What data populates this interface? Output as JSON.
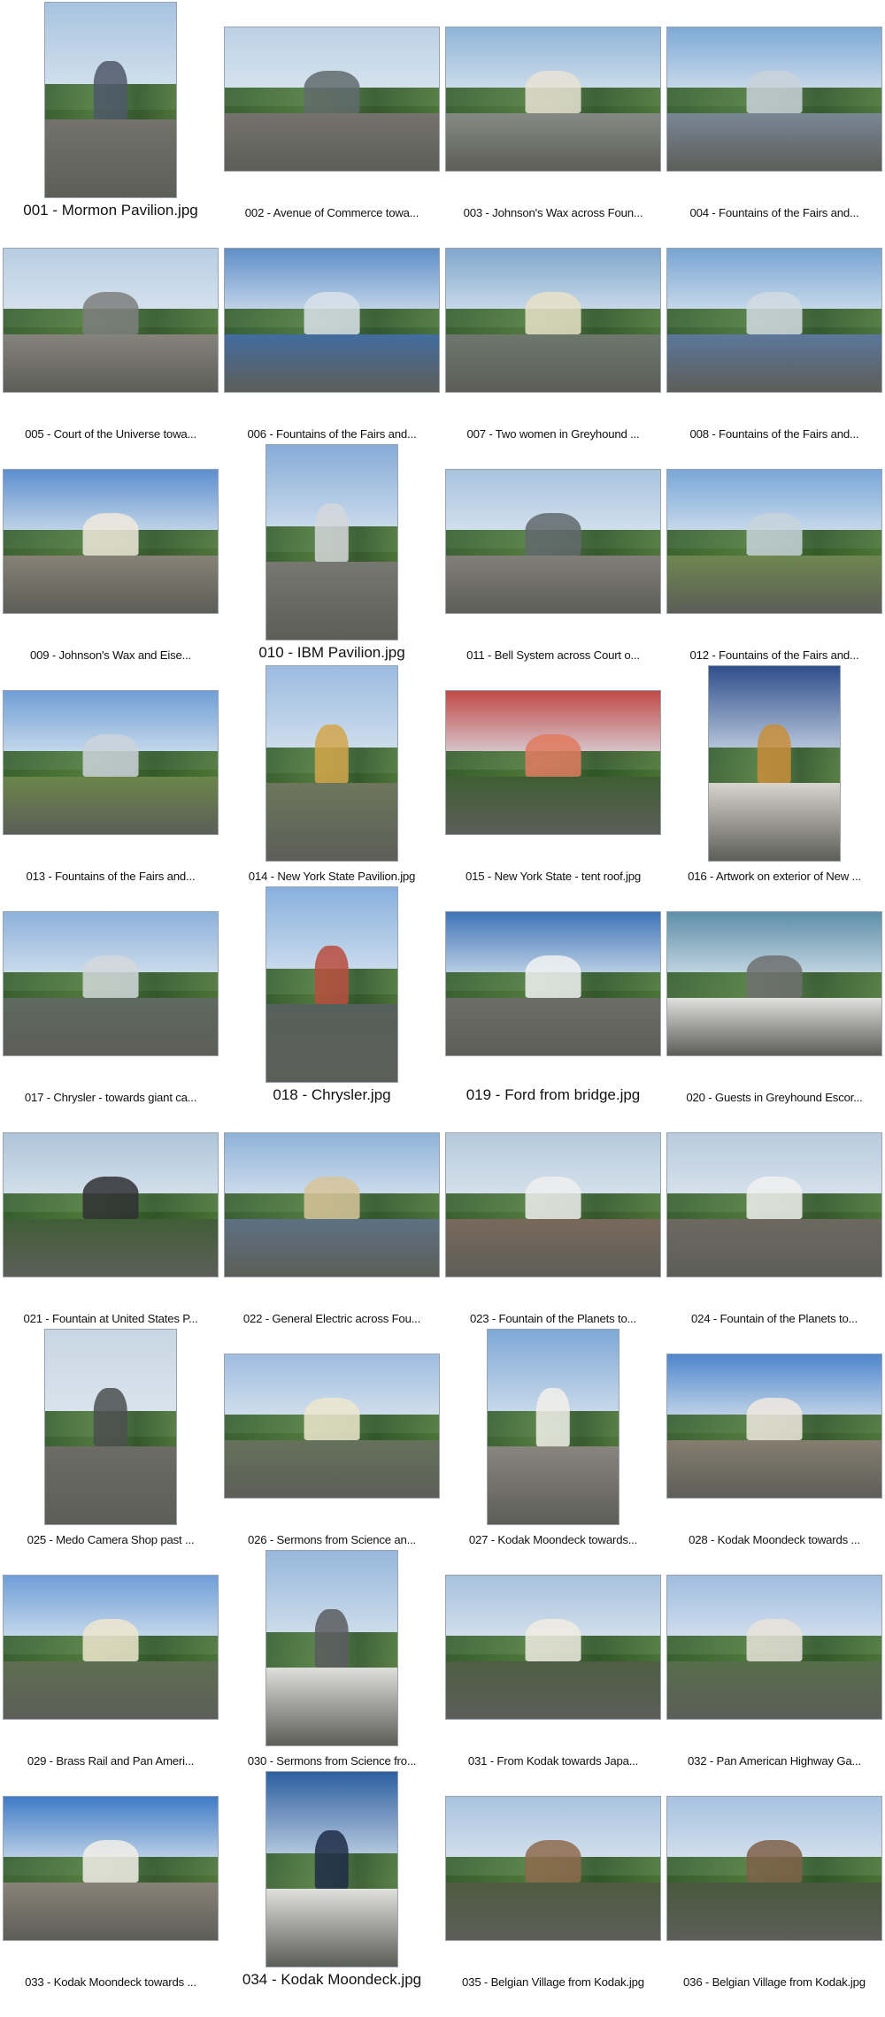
{
  "photos": [
    {
      "caption": "001 - Mormon Pavilion.jpg",
      "orientation": "portrait",
      "sky": "#a7c3e0",
      "ground": "#75756d",
      "accent": "#4e5868"
    },
    {
      "caption": "002 - Avenue of Commerce towa...",
      "orientation": "landscape",
      "sky": "#bcd1e6",
      "ground": "#77766f",
      "accent": "#5f6b6c"
    },
    {
      "caption": "003 - Johnson's Wax across Foun...",
      "orientation": "landscape",
      "sky": "#8fb4d8",
      "ground": "#8c8f89",
      "accent": "#e8e3d6"
    },
    {
      "caption": "004 - Fountains of the Fairs and...",
      "orientation": "landscape",
      "sky": "#7ea9d6",
      "ground": "#7d8c9d",
      "accent": "#c8d2d9"
    },
    {
      "caption": "005 - Court of the Universe towa...",
      "orientation": "landscape",
      "sky": "#b8cde3",
      "ground": "#8a8880",
      "accent": "#7c7f7c"
    },
    {
      "caption": "006 - Fountains of the Fairs and...",
      "orientation": "landscape",
      "sky": "#5f8fc8",
      "ground": "#3f6ea8",
      "accent": "#d8e2ea"
    },
    {
      "caption": "007 - Two women in Greyhound ...",
      "orientation": "landscape",
      "sky": "#7fa7cc",
      "ground": "#6f7a6f",
      "accent": "#e8e2c8"
    },
    {
      "caption": "008 - Fountains of the Fairs and...",
      "orientation": "landscape",
      "sky": "#78a5d3",
      "ground": "#5c7aa3",
      "accent": "#d1dbe2"
    },
    {
      "caption": "009 - Johnson's Wax and Eise...",
      "orientation": "landscape",
      "sky": "#5d8fcf",
      "ground": "#8b8678",
      "accent": "#efe9dc"
    },
    {
      "caption": "010 - IBM Pavilion.jpg",
      "orientation": "portrait",
      "sky": "#86acd8",
      "ground": "#7b7a74",
      "accent": "#d3d7da"
    },
    {
      "caption": "011 - Bell System across Court o...",
      "orientation": "landscape",
      "sky": "#a9c3df",
      "ground": "#85837c",
      "accent": "#62686d"
    },
    {
      "caption": "012 - Fountains of the Fairs and...",
      "orientation": "landscape",
      "sky": "#79a7d8",
      "ground": "#6f8c4e",
      "accent": "#c7d3db"
    },
    {
      "caption": "013 - Fountains of the Fairs and...",
      "orientation": "landscape",
      "sky": "#6f9fd6",
      "ground": "#6c8a47",
      "accent": "#cbd4db"
    },
    {
      "caption": "014 - New York State Pavilion.jpg",
      "orientation": "portrait",
      "sky": "#9bbbe0",
      "ground": "#6f7a5c",
      "accent": "#d2a64b"
    },
    {
      "caption": "015 - New York State - tent roof.jpg",
      "orientation": "landscape",
      "sky": "#c04a48",
      "ground": "#3b5e2e",
      "accent": "#e07a5f"
    },
    {
      "caption": "016 - Artwork on exterior of New ...",
      "orientation": "portrait",
      "sky": "#2f4f8c",
      "ground": "#e7e3dc",
      "accent": "#c98d3a"
    },
    {
      "caption": "017 - Chrysler - towards giant ca...",
      "orientation": "landscape",
      "sky": "#8cb1db",
      "ground": "#5f6b5e",
      "accent": "#d4d8dc"
    },
    {
      "caption": "018 - Chrysler.jpg",
      "orientation": "portrait",
      "sky": "#88b0de",
      "ground": "#55605c",
      "accent": "#b84d3d"
    },
    {
      "caption": "019 - Ford from bridge.jpg",
      "orientation": "landscape",
      "sky": "#3f74b8",
      "ground": "#6e6f68",
      "accent": "#f1f2f2"
    },
    {
      "caption": "020 - Guests in Greyhound Escor...",
      "orientation": "landscape",
      "sky": "#5d8fa8",
      "ground": "#f0f0ee",
      "accent": "#6e706e"
    },
    {
      "caption": "021 - Fountain at United States P...",
      "orientation": "landscape",
      "sky": "#aec4d9",
      "ground": "#3d5e33",
      "accent": "#2f3033"
    },
    {
      "caption": "022 - General Electric across Fou...",
      "orientation": "landscape",
      "sky": "#8fb2d8",
      "ground": "#5d7388",
      "accent": "#d7c49a"
    },
    {
      "caption": "023 - Fountain of the Planets to...",
      "orientation": "landscape",
      "sky": "#b6cadc",
      "ground": "#7c6a5c",
      "accent": "#efefee"
    },
    {
      "caption": "024 - Fountain of the Planets to...",
      "orientation": "landscape",
      "sky": "#b9cbdd",
      "ground": "#6e6a62",
      "accent": "#f0f0ef"
    },
    {
      "caption": "025 - Medo Camera Shop past ...",
      "orientation": "portrait",
      "sky": "#c8d6e3",
      "ground": "#6e6d68",
      "accent": "#4b4f4f"
    },
    {
      "caption": "026 - Sermons from Science an...",
      "orientation": "landscape",
      "sky": "#9fbde0",
      "ground": "#66745a",
      "accent": "#ede6cf"
    },
    {
      "caption": "027 - Kodak Moondeck towards...",
      "orientation": "portrait",
      "sky": "#7fa8d6",
      "ground": "#8d8a82",
      "accent": "#f2f0ea"
    },
    {
      "caption": "028 - Kodak Moondeck towards ...",
      "orientation": "landscape",
      "sky": "#4f86cc",
      "ground": "#8a8273",
      "accent": "#efe9df"
    },
    {
      "caption": "029 - Brass Rail and Pan Ameri...",
      "orientation": "landscape",
      "sky": "#6f9fd8",
      "ground": "#5e7050",
      "accent": "#efe6cf"
    },
    {
      "caption": "030 - Sermons from Science fro...",
      "orientation": "portrait",
      "sky": "#97b7db",
      "ground": "#eeeeec",
      "accent": "#5a5c60"
    },
    {
      "caption": "031 - From Kodak towards Japa...",
      "orientation": "landscape",
      "sky": "#a8c1de",
      "ground": "#4c5e42",
      "accent": "#f0ece2"
    },
    {
      "caption": "032 - Pan American Highway Ga...",
      "orientation": "landscape",
      "sky": "#a0bde0",
      "ground": "#56704a",
      "accent": "#e8e3d9"
    },
    {
      "caption": "033 - Kodak Moondeck towards ...",
      "orientation": "landscape",
      "sky": "#3f7bc6",
      "ground": "#8d877c",
      "accent": "#f2efe7"
    },
    {
      "caption": "034 - Kodak Moondeck.jpg",
      "orientation": "portrait",
      "sky": "#2d5fa0",
      "ground": "#f1f1ef",
      "accent": "#1f2c46"
    },
    {
      "caption": "035 - Belgian Village from Kodak.jpg",
      "orientation": "landscape",
      "sky": "#a9c3df",
      "ground": "#4d5a3d",
      "accent": "#8e6a4c"
    },
    {
      "caption": "036 - Belgian Village from Kodak.jpg",
      "orientation": "landscape",
      "sky": "#a7c2e0",
      "ground": "#46583a",
      "accent": "#7f6048"
    }
  ]
}
